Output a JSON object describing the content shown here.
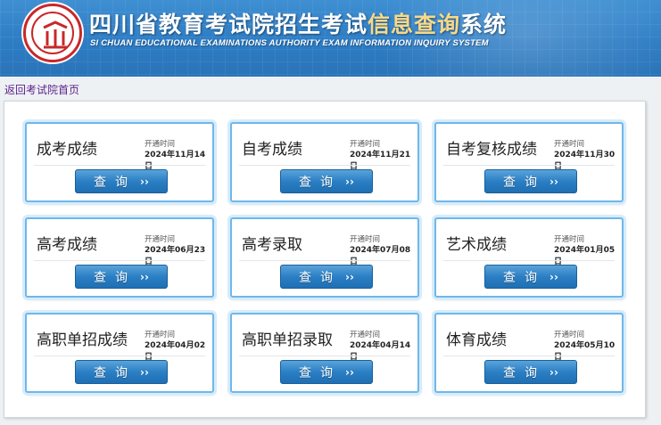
{
  "header": {
    "title_main": "四川省教育考试院招生考试",
    "title_accent": "信息查询",
    "title_tail": "系统",
    "subtitle": "SI CHUAN EDUCATIONAL EXAMINATIONS AUTHORITY EXAM INFORMATION INQUIRY SYSTEM",
    "logo_icon": "institution-seal-logo"
  },
  "back_link": "返回考试院首页",
  "open_label": "开通时间",
  "query_label": "查询",
  "query_arrow": "››",
  "cards": [
    {
      "name": "成考成绩",
      "date": "2024年11月14日"
    },
    {
      "name": "自考成绩",
      "date": "2024年11月21日"
    },
    {
      "name": "自考复核成绩",
      "date": "2024年11月30日"
    },
    {
      "name": "高考成绩",
      "date": "2024年06月23日"
    },
    {
      "name": "高考录取",
      "date": "2024年07月08日"
    },
    {
      "name": "艺术成绩",
      "date": "2024年01月05日"
    },
    {
      "name": "高职单招成绩",
      "date": "2024年04月02日"
    },
    {
      "name": "高职单招录取",
      "date": "2024年04月14日"
    },
    {
      "name": "体育成绩",
      "date": "2024年05月10日"
    }
  ],
  "colors": {
    "header_blue": "#2d7cc4",
    "accent_gold": "#f6d98a",
    "card_border": "#6fb7ea",
    "button_blue": "#2b7fc4",
    "logo_red": "#c8282a"
  }
}
